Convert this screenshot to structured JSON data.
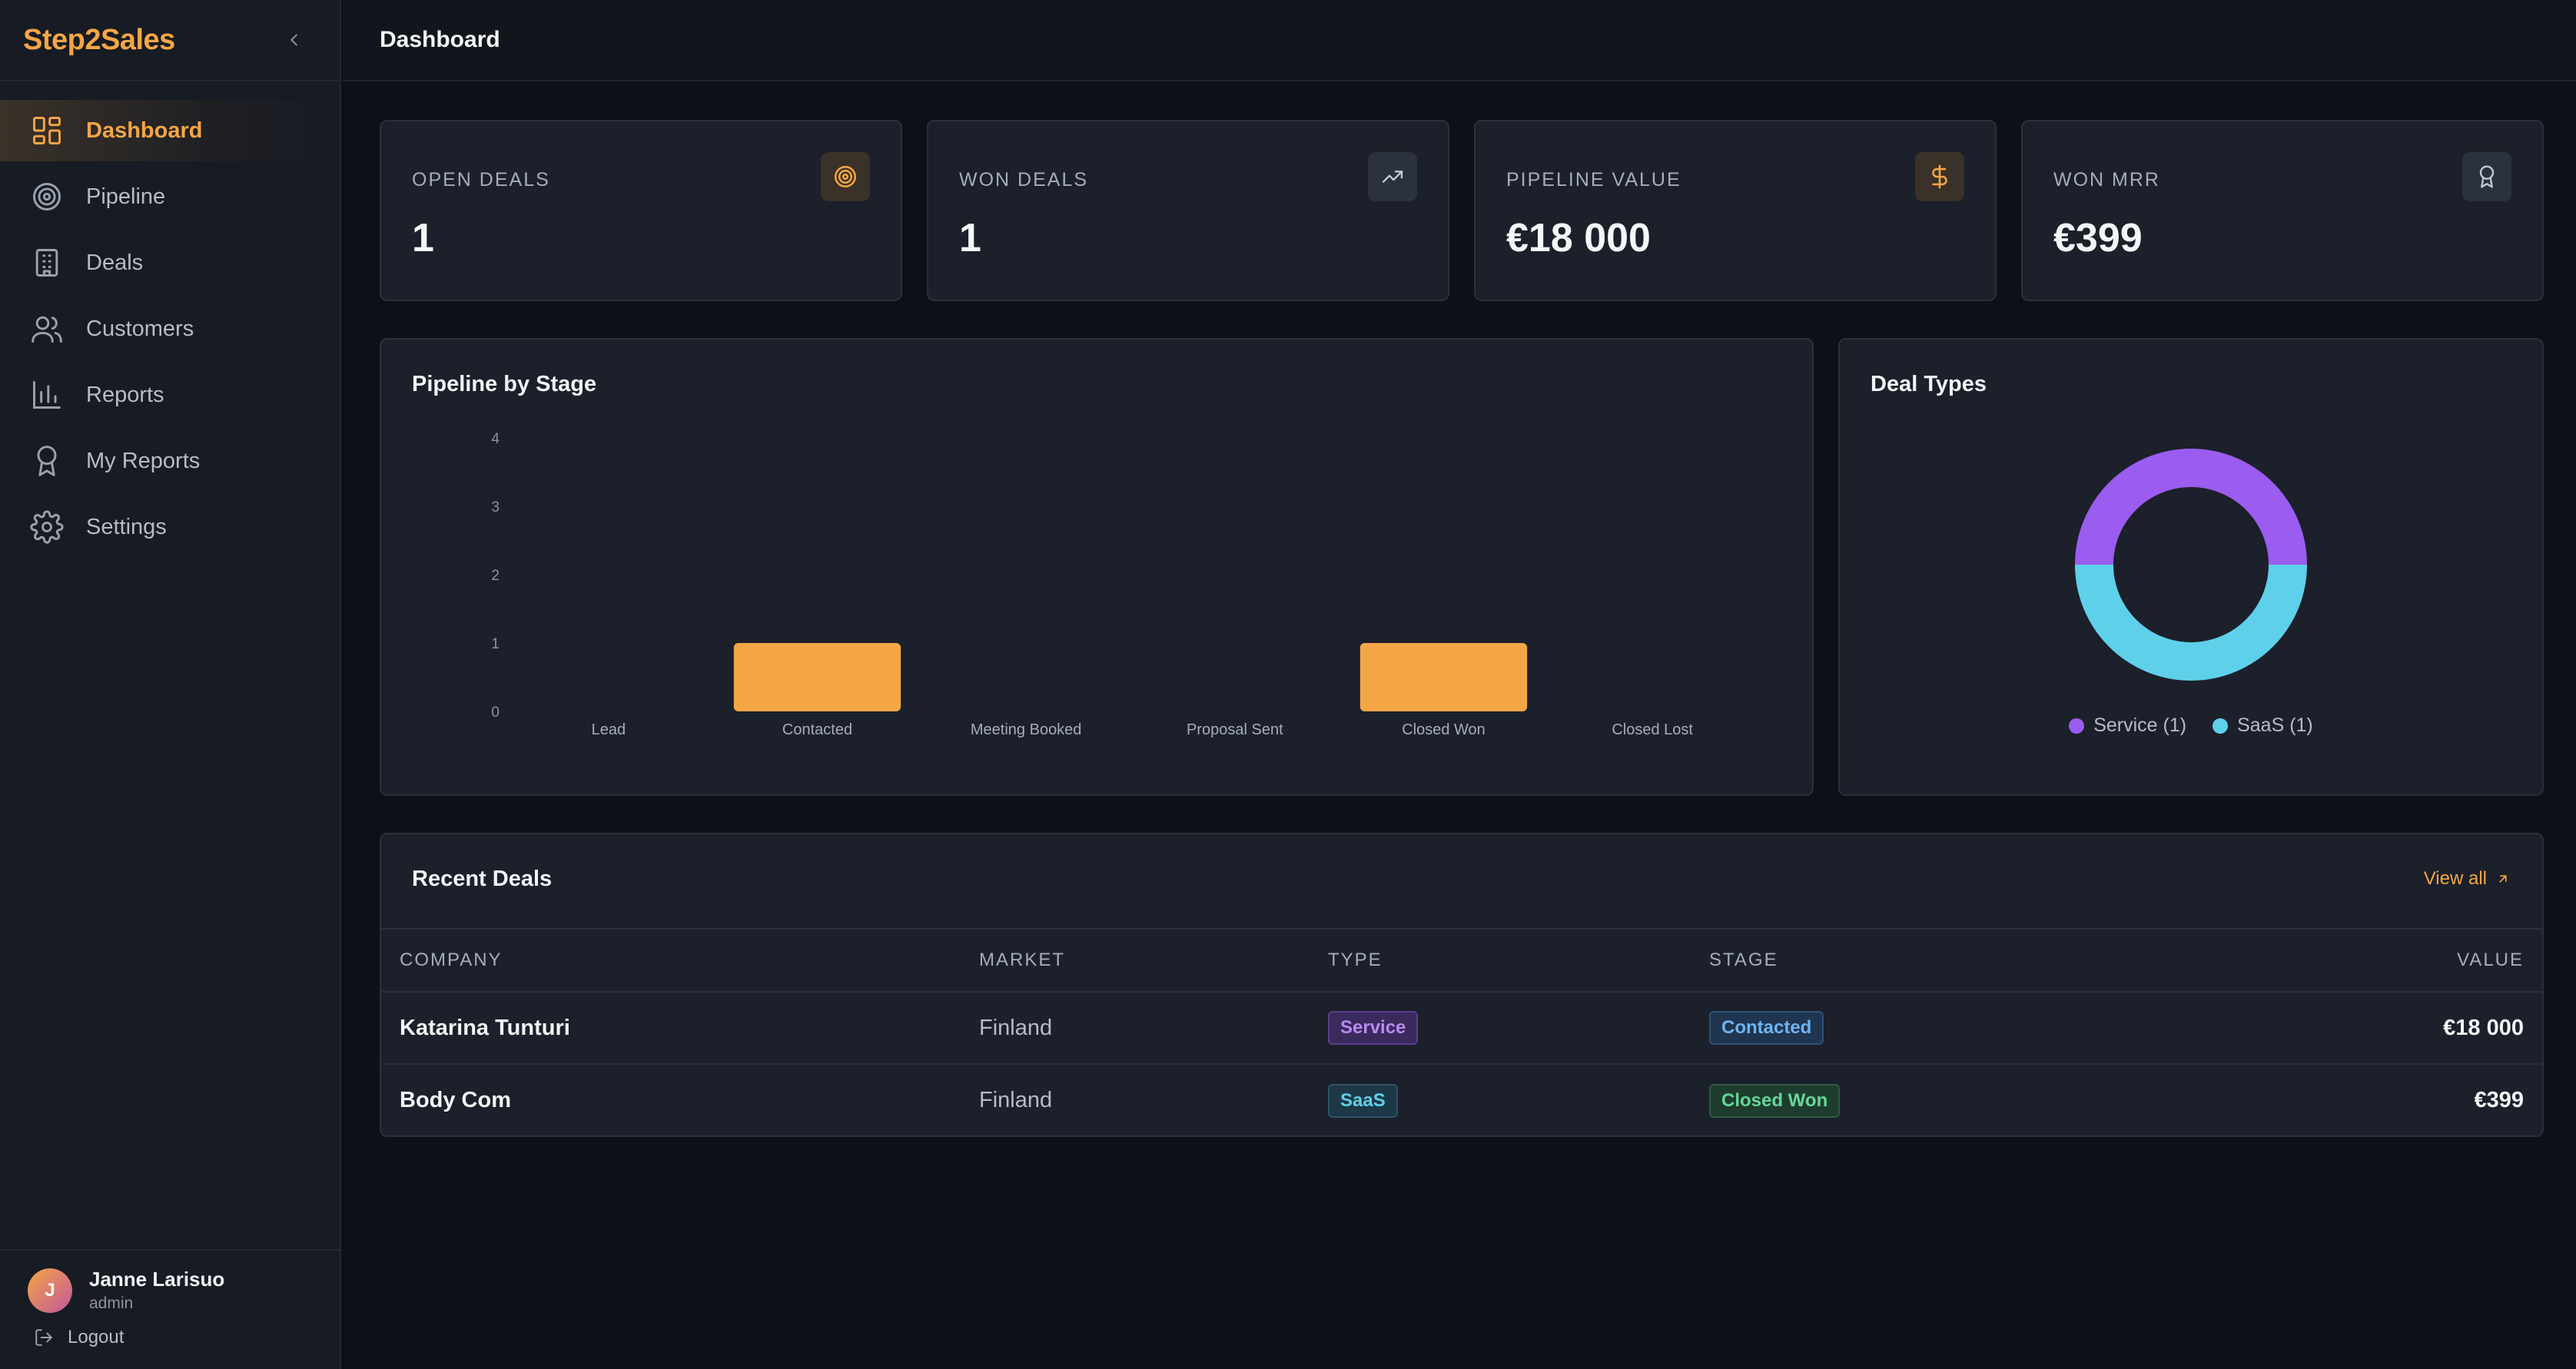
{
  "brand": {
    "name": "Step2Sales"
  },
  "sidebar": {
    "items": [
      {
        "label": "Dashboard",
        "icon": "dashboard-grid-icon",
        "active": true
      },
      {
        "label": "Pipeline",
        "icon": "target-icon",
        "active": false
      },
      {
        "label": "Deals",
        "icon": "building-icon",
        "active": false
      },
      {
        "label": "Customers",
        "icon": "users-icon",
        "active": false
      },
      {
        "label": "Reports",
        "icon": "bar-chart-icon",
        "active": false
      },
      {
        "label": "My Reports",
        "icon": "award-icon",
        "active": false
      },
      {
        "label": "Settings",
        "icon": "gear-icon",
        "active": false
      }
    ],
    "user": {
      "initial": "J",
      "name": "Janne Larisuo",
      "role": "admin"
    },
    "logout_label": "Logout"
  },
  "header": {
    "title": "Dashboard"
  },
  "kpis": [
    {
      "label": "OPEN DEALS",
      "value": "1",
      "icon": "target-icon"
    },
    {
      "label": "WON DEALS",
      "value": "1",
      "icon": "trending-up-icon"
    },
    {
      "label": "PIPELINE VALUE",
      "value": "€18 000",
      "icon": "dollar-icon"
    },
    {
      "label": "WON MRR",
      "value": "€399",
      "icon": "award-icon"
    }
  ],
  "pipeline_card": {
    "title": "Pipeline by Stage"
  },
  "deal_types_card": {
    "title": "Deal Types",
    "legend": [
      {
        "label": "Service (1)",
        "color": "#9b5cf0"
      },
      {
        "label": "SaaS (1)",
        "color": "#5fd0ea"
      }
    ]
  },
  "recent_deals": {
    "title": "Recent Deals",
    "view_all_label": "View all",
    "columns": [
      "COMPANY",
      "MARKET",
      "TYPE",
      "STAGE",
      "VALUE"
    ],
    "rows": [
      {
        "company": "Katarina Tunturi",
        "market": "Finland",
        "type": "Service",
        "stage": "Contacted",
        "value": "€18 000"
      },
      {
        "company": "Body Com",
        "market": "Finland",
        "type": "SaaS",
        "stage": "Closed Won",
        "value": "€399"
      }
    ]
  },
  "colors": {
    "accent": "#f4a646",
    "bar": "#f4a646",
    "service": "#9b5cf0",
    "saas": "#5fd0ea"
  },
  "chart_data": [
    {
      "type": "bar",
      "title": "Pipeline by Stage",
      "categories": [
        "Lead",
        "Contacted",
        "Meeting Booked",
        "Proposal Sent",
        "Closed Won",
        "Closed Lost"
      ],
      "values": [
        0,
        1,
        0,
        0,
        1,
        0
      ],
      "yticks": [
        "0",
        "1",
        "2",
        "3",
        "4"
      ],
      "ylim": [
        0,
        4
      ],
      "grid": false,
      "legend": "none"
    },
    {
      "type": "pie",
      "title": "Deal Types",
      "donut": true,
      "categories": [
        "Service",
        "SaaS"
      ],
      "values": [
        1,
        1
      ],
      "legend": "bottom"
    }
  ]
}
